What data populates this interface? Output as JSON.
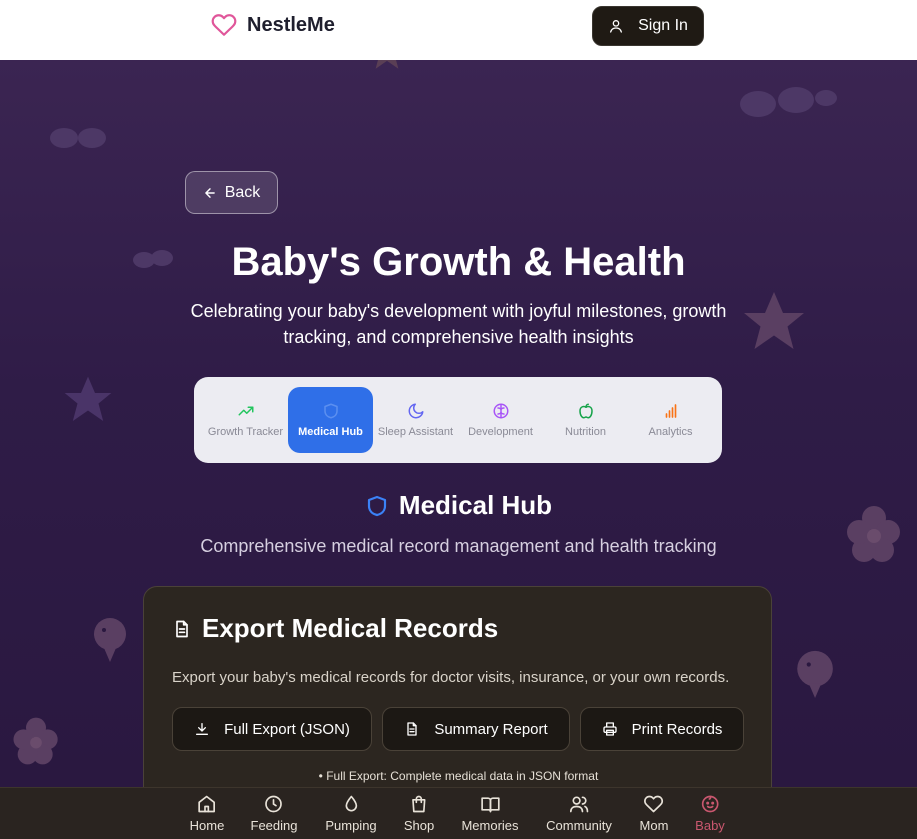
{
  "header": {
    "brand": "NestleMe",
    "sign_in": "Sign In"
  },
  "page": {
    "back": "Back",
    "title": "Baby's Growth & Health",
    "subtitle": "Celebrating your baby's development with joyful milestones, growth tracking, and comprehensive health insights"
  },
  "tabs": [
    {
      "label": "Growth Tracker",
      "icon": "trending-up-icon",
      "color": "#22c55e"
    },
    {
      "label": "Medical Hub",
      "icon": "shield-icon",
      "color": "#2f6fe8",
      "active": true
    },
    {
      "label": "Sleep Assistant",
      "icon": "moon-icon",
      "color": "#6366f1"
    },
    {
      "label": "Development",
      "icon": "brain-icon",
      "color": "#a855f7"
    },
    {
      "label": "Nutrition",
      "icon": "apple-icon",
      "color": "#16a34a"
    },
    {
      "label": "Analytics",
      "icon": "bar-chart-icon",
      "color": "#f97316"
    }
  ],
  "section": {
    "title": "Medical Hub",
    "subtitle": "Comprehensive medical record management and health tracking"
  },
  "export_card": {
    "title": "Export Medical Records",
    "description": "Export your baby's medical records for doctor visits, insurance, or your own records.",
    "buttons": [
      {
        "label": "Full Export (JSON)",
        "icon": "download-icon"
      },
      {
        "label": "Summary Report",
        "icon": "file-text-icon"
      },
      {
        "label": "Print Records",
        "icon": "printer-icon"
      }
    ],
    "note": "• Full Export: Complete medical data in JSON format"
  },
  "bottom_nav": [
    {
      "label": "Home",
      "icon": "home-icon"
    },
    {
      "label": "Feeding",
      "icon": "clock-icon"
    },
    {
      "label": "Pumping",
      "icon": "droplet-icon"
    },
    {
      "label": "Shop",
      "icon": "shopping-bag-icon"
    },
    {
      "label": "Memories",
      "icon": "book-open-icon"
    },
    {
      "label": "Community",
      "icon": "users-icon"
    },
    {
      "label": "Mom",
      "icon": "heart-icon"
    },
    {
      "label": "Baby",
      "icon": "baby-face-icon",
      "active": true
    }
  ],
  "colors": {
    "brand_pink": "#e0569a",
    "active_tab": "#2f6fe8",
    "active_nav": "#c9576f"
  }
}
